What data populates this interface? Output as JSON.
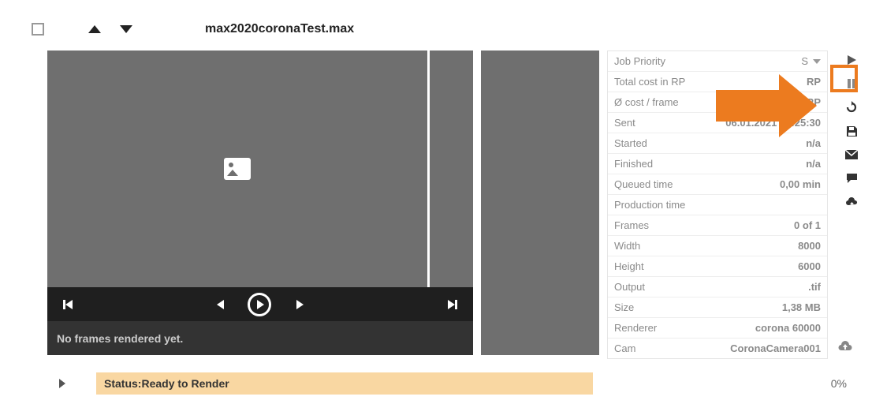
{
  "header": {
    "filename": "max2020coronaTest.max"
  },
  "preview": {
    "status_message": "No frames rendered yet."
  },
  "details": {
    "rows": [
      {
        "label": "Job Priority",
        "value": "S",
        "kind": "priority"
      },
      {
        "label": "Total cost in RP",
        "value": "RP"
      },
      {
        "label": "Ø cost / frame",
        "value": "0,00 RP"
      },
      {
        "label": "Sent",
        "value": "06.01.2021 12:25:30"
      },
      {
        "label": "Started",
        "value": "n/a"
      },
      {
        "label": "Finished",
        "value": "n/a"
      },
      {
        "label": "Queued time",
        "value": "0,00 min"
      },
      {
        "label": "Production time",
        "value": ""
      },
      {
        "label": "Frames",
        "value": "0 of 1"
      },
      {
        "label": "Width",
        "value": "8000"
      },
      {
        "label": "Height",
        "value": "6000"
      },
      {
        "label": "Output",
        "value": ".tif"
      },
      {
        "label": "Size",
        "value": "1,38 MB"
      },
      {
        "label": "Renderer",
        "value": "corona 60000"
      },
      {
        "label": "Cam",
        "value": "CoronaCamera001"
      }
    ]
  },
  "footer": {
    "status_prefix": "Status: ",
    "status_text": "Ready to Render",
    "percent": "0%"
  }
}
